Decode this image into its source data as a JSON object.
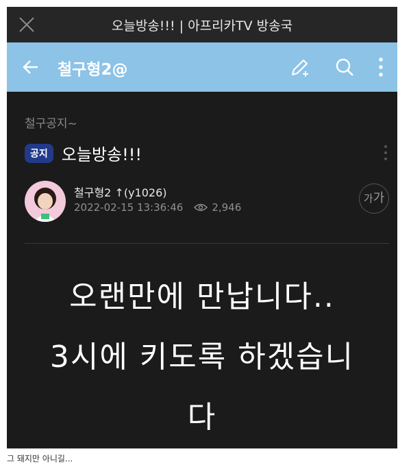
{
  "titlebar": {
    "title": "오늘방송!!! | 아프리카TV 방송국"
  },
  "appbar": {
    "board_name": "철구형2@"
  },
  "post": {
    "category": "철구공지~",
    "badge": "공지",
    "title": "오늘방송!!!",
    "author": "철구형2 ↑(y1026)",
    "datetime": "2022-02-15 13:36:46",
    "views": "2,946",
    "font_size_small": "가",
    "font_size_large": "가",
    "body_lines": [
      "오랜만에 만납니다..",
      "3시에 키도록 하겠습니",
      "다"
    ]
  },
  "caption": "그 돼지만 아니길...",
  "colors": {
    "appbar": "#8cc3e7",
    "badge": "#223a8a",
    "background": "#1b1b1b"
  }
}
